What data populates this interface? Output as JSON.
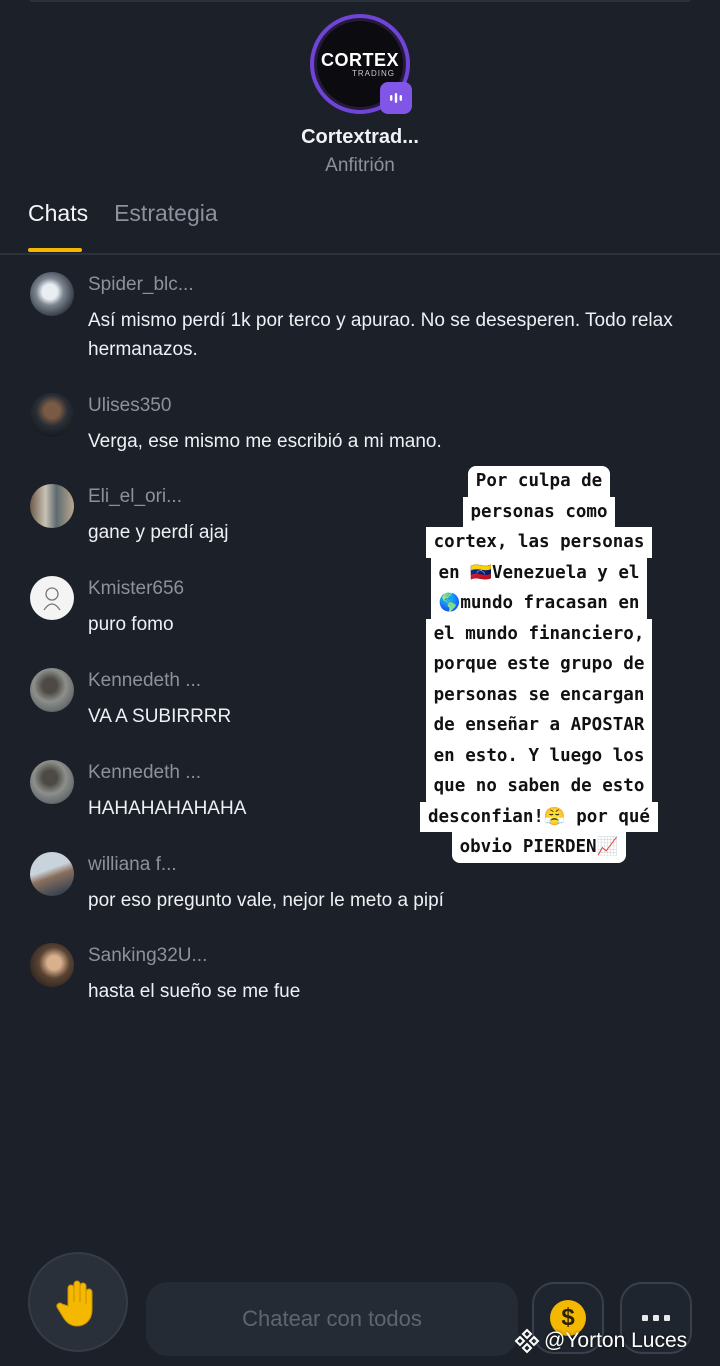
{
  "host": {
    "logo_text": "CORTEX",
    "logo_sub": "TRADING",
    "name": "Cortextrad...",
    "role": "Anfitrión"
  },
  "tabs": [
    {
      "label": "Chats",
      "active": true
    },
    {
      "label": "Estrategia",
      "active": false
    }
  ],
  "messages": [
    {
      "user": "Spider_blc...",
      "text": "Así mismo perdí 1k por terco y apurao. No se desesperen. Todo relax hermanazos."
    },
    {
      "user": "Ulises350",
      "text": "Verga, ese mismo me escribió a mi mano."
    },
    {
      "user": "Eli_el_ori...",
      "text": "gane y perdí ajaj"
    },
    {
      "user": "Kmister656",
      "text": "puro fomo"
    },
    {
      "user": "Kennedeth ...",
      "text": "VA A SUBIRRRR"
    },
    {
      "user": "Kennedeth ...",
      "text": "HAHAHAHAHAHA"
    },
    {
      "user": "williana f...",
      "text": "por eso pregunto vale, nejor le meto  a pipí"
    },
    {
      "user": "Sanking32U...",
      "text": "hasta el sueño se me fue"
    }
  ],
  "overlay": {
    "lines": [
      "Por culpa de",
      "personas como",
      "cortex, las personas",
      "en 🇻🇪Venezuela y el",
      "🌎mundo fracasan en",
      "el mundo financiero,",
      "porque este grupo de",
      "personas se encargan",
      "de enseñar a APOSTAR",
      "en esto. Y luego los",
      "que no saben de esto",
      "desconfian!😤 por qué",
      "obvio PIERDEN📈"
    ]
  },
  "bottom": {
    "input_placeholder": "Chatear con todos",
    "coin_symbol": "$"
  },
  "watermark": {
    "text": "@Yorton Luces"
  },
  "colors": {
    "background": "#1b2029",
    "accent_yellow": "#f5b800",
    "accent_purple": "#6f44d6",
    "muted_text": "#8c929c"
  }
}
